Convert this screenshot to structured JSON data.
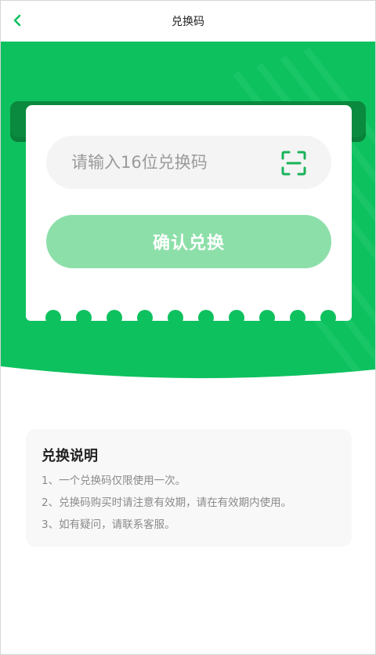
{
  "nav": {
    "back_icon": "chevron-left-icon",
    "title": "兑换码"
  },
  "colors": {
    "brand_green": "#0ec15f",
    "dark_green": "#0a8a3e",
    "button_disabled": "#8ddfa9",
    "input_bg": "#f4f4f4",
    "info_bg": "#f8f8f8",
    "hint_text": "#8a8a8a"
  },
  "redeem": {
    "placeholder": "请输入16位兑换码",
    "value": "",
    "scan_icon": "scan-icon",
    "confirm_label": "确认兑换"
  },
  "instructions": {
    "title": "兑换说明",
    "items": [
      "1、一个兑换码仅限使用一次。",
      "2、兑换码购买时请注意有效期，请在有效期内使用。",
      "3、如有疑问，请联系客服。"
    ]
  }
}
